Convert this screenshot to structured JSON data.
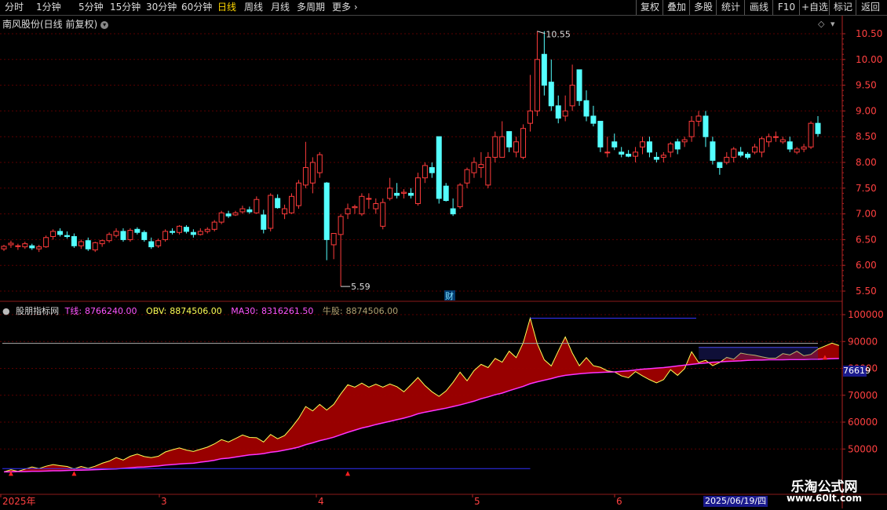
{
  "toolbar": {
    "periods": [
      "分时",
      "1分钟",
      "5分钟",
      "15分钟",
      "30分钟",
      "60分钟",
      "日线",
      "周线",
      "月线",
      "多周期",
      "更多"
    ],
    "active_period": "日线",
    "right_buttons": [
      "复权",
      "叠加",
      "多股",
      "统计",
      "画线",
      "F10",
      "+自选",
      "标记",
      "返回"
    ]
  },
  "main_panel": {
    "title": "南风股份(日线 前复权)",
    "y_ticks": [
      "10.50",
      "10.00",
      "9.50",
      "9.00",
      "8.50",
      "8.00",
      "7.50",
      "7.00",
      "6.50",
      "6.00",
      "5.50"
    ],
    "high_label": "10.55",
    "low_label": "5.59",
    "finance_marker": "财"
  },
  "indicator_panel": {
    "name": "股朋指标网",
    "fields": [
      {
        "label": "T线:",
        "value": "8766240.00",
        "color": "#ff55ff"
      },
      {
        "label": "OBV:",
        "value": "8874506.00",
        "color": "#ffff55"
      },
      {
        "label": "MA30:",
        "value": "8316261.50",
        "color": "#ff55ff"
      },
      {
        "label": "牛股:",
        "value": "8874506.00",
        "color": "#b0a070"
      }
    ],
    "y_ticks": [
      "100000",
      "90000",
      "80000",
      "70000",
      "60000",
      "50000"
    ],
    "current_value": "76619"
  },
  "x_axis": {
    "labels": [
      "2025年",
      "3",
      "4",
      "5",
      "6"
    ],
    "cursor_date": "2025/06/19/四"
  },
  "watermark": {
    "name": "乐淘公式网",
    "url": "www.60lt.com"
  },
  "colors": {
    "up": "#ff3b3b",
    "down": "#54ffff",
    "grid": "#5a0000",
    "axis": "#b22222",
    "fill": "#a00000"
  },
  "chart_data": [
    {
      "type": "candlestick",
      "title": "南风股份(日线 前复权)",
      "ylim": [
        5.4,
        10.6
      ],
      "ohlc": [
        [
          6.32,
          6.4,
          6.28,
          6.37
        ],
        [
          6.4,
          6.48,
          6.34,
          6.43
        ],
        [
          6.37,
          6.42,
          6.3,
          6.38
        ],
        [
          6.36,
          6.46,
          6.32,
          6.42
        ],
        [
          6.38,
          6.42,
          6.3,
          6.34
        ],
        [
          6.32,
          6.4,
          6.26,
          6.36
        ],
        [
          6.36,
          6.58,
          6.34,
          6.54
        ],
        [
          6.56,
          6.7,
          6.5,
          6.66
        ],
        [
          6.66,
          6.72,
          6.56,
          6.6
        ],
        [
          6.58,
          6.66,
          6.52,
          6.56
        ],
        [
          6.56,
          6.62,
          6.34,
          6.38
        ],
        [
          6.38,
          6.5,
          6.32,
          6.46
        ],
        [
          6.48,
          6.54,
          6.28,
          6.32
        ],
        [
          6.3,
          6.46,
          6.26,
          6.44
        ],
        [
          6.42,
          6.5,
          6.36,
          6.48
        ],
        [
          6.48,
          6.64,
          6.44,
          6.6
        ],
        [
          6.58,
          6.72,
          6.54,
          6.66
        ],
        [
          6.66,
          6.72,
          6.46,
          6.5
        ],
        [
          6.5,
          6.72,
          6.46,
          6.68
        ],
        [
          6.7,
          6.74,
          6.6,
          6.64
        ],
        [
          6.64,
          6.68,
          6.46,
          6.5
        ],
        [
          6.46,
          6.54,
          6.32,
          6.36
        ],
        [
          6.38,
          6.52,
          6.34,
          6.48
        ],
        [
          6.5,
          6.7,
          6.46,
          6.66
        ],
        [
          6.66,
          6.72,
          6.6,
          6.64
        ],
        [
          6.64,
          6.78,
          6.6,
          6.76
        ],
        [
          6.74,
          6.78,
          6.62,
          6.66
        ],
        [
          6.64,
          6.7,
          6.54,
          6.6
        ],
        [
          6.6,
          6.72,
          6.58,
          6.66
        ],
        [
          6.66,
          6.74,
          6.62,
          6.7
        ],
        [
          6.7,
          6.88,
          6.66,
          6.84
        ],
        [
          6.84,
          7.06,
          6.8,
          7.02
        ],
        [
          7.0,
          7.06,
          6.92,
          6.96
        ],
        [
          6.98,
          7.06,
          6.96,
          7.02
        ],
        [
          7.04,
          7.16,
          7.0,
          7.1
        ],
        [
          7.08,
          7.14,
          7.0,
          7.04
        ],
        [
          7.02,
          7.34,
          7.0,
          7.28
        ],
        [
          6.98,
          7.08,
          6.62,
          6.7
        ],
        [
          6.72,
          7.4,
          6.66,
          7.36
        ],
        [
          7.3,
          7.38,
          7.1,
          7.12
        ],
        [
          7.0,
          7.18,
          6.9,
          7.1
        ],
        [
          7.02,
          7.4,
          7.0,
          7.34
        ],
        [
          7.16,
          7.66,
          7.1,
          7.6
        ],
        [
          7.56,
          8.4,
          7.5,
          7.9
        ],
        [
          7.6,
          8.1,
          7.4,
          8.0
        ],
        [
          7.8,
          8.2,
          7.7,
          8.15
        ],
        [
          7.6,
          7.62,
          6.1,
          6.5
        ],
        [
          6.4,
          6.6,
          6.12,
          6.62
        ],
        [
          6.6,
          7.0,
          5.59,
          6.95
        ],
        [
          7.0,
          7.2,
          6.9,
          7.1
        ],
        [
          7.12,
          7.18,
          7.0,
          7.14
        ],
        [
          7.0,
          7.4,
          6.96,
          7.34
        ],
        [
          7.3,
          7.4,
          7.1,
          7.3
        ],
        [
          7.1,
          7.3,
          7.0,
          7.2
        ],
        [
          6.76,
          7.3,
          6.7,
          7.22
        ],
        [
          7.3,
          7.7,
          7.26,
          7.5
        ],
        [
          7.4,
          7.6,
          7.3,
          7.36
        ],
        [
          7.4,
          7.48,
          7.3,
          7.42
        ],
        [
          7.4,
          7.5,
          7.3,
          7.36
        ],
        [
          7.2,
          7.8,
          7.16,
          7.7
        ],
        [
          7.7,
          8.0,
          7.6,
          7.94
        ],
        [
          7.9,
          8.0,
          7.7,
          7.8
        ],
        [
          8.5,
          8.5,
          7.2,
          7.3
        ],
        [
          7.54,
          7.6,
          7.24,
          7.26
        ],
        [
          7.1,
          7.3,
          6.96,
          7.0
        ],
        [
          7.14,
          7.6,
          7.1,
          7.56
        ],
        [
          7.6,
          7.9,
          7.5,
          7.86
        ],
        [
          7.8,
          8.1,
          7.7,
          8.0
        ],
        [
          7.9,
          8.2,
          7.7,
          7.96
        ],
        [
          7.56,
          8.2,
          7.5,
          8.1
        ],
        [
          8.1,
          8.6,
          8.0,
          8.5
        ],
        [
          8.1,
          8.8,
          8.1,
          8.5
        ],
        [
          8.6,
          8.6,
          8.2,
          8.3
        ],
        [
          8.2,
          8.5,
          8.1,
          8.4
        ],
        [
          8.1,
          8.74,
          8.06,
          8.66
        ],
        [
          8.76,
          9.7,
          8.6,
          9.0
        ],
        [
          9.0,
          10.55,
          8.9,
          10.0
        ],
        [
          10.1,
          10.55,
          9.3,
          9.5
        ],
        [
          9.56,
          10.0,
          9.0,
          9.1
        ],
        [
          9.1,
          9.3,
          8.76,
          8.86
        ],
        [
          8.9,
          9.3,
          8.8,
          9.0
        ],
        [
          9.1,
          9.9,
          9.0,
          9.5
        ],
        [
          9.8,
          9.8,
          9.1,
          9.2
        ],
        [
          9.2,
          9.4,
          8.8,
          8.9
        ],
        [
          8.9,
          9.1,
          8.7,
          8.76
        ],
        [
          8.8,
          8.8,
          8.2,
          8.3
        ],
        [
          8.2,
          8.5,
          8.1,
          8.2
        ],
        [
          8.4,
          8.56,
          8.24,
          8.3
        ],
        [
          8.2,
          8.3,
          8.1,
          8.16
        ],
        [
          8.16,
          8.24,
          8.1,
          8.12
        ],
        [
          8.12,
          8.3,
          8.0,
          8.2
        ],
        [
          8.3,
          8.5,
          8.16,
          8.4
        ],
        [
          8.4,
          8.5,
          8.1,
          8.2
        ],
        [
          8.1,
          8.2,
          8.0,
          8.06
        ],
        [
          8.1,
          8.2,
          8.0,
          8.14
        ],
        [
          8.2,
          8.4,
          8.1,
          8.36
        ],
        [
          8.4,
          8.46,
          8.16,
          8.26
        ],
        [
          8.4,
          8.5,
          8.3,
          8.44
        ],
        [
          8.5,
          8.9,
          8.4,
          8.8
        ],
        [
          8.8,
          9.0,
          8.7,
          8.9
        ],
        [
          8.9,
          9.0,
          8.3,
          8.5
        ],
        [
          8.4,
          8.5,
          7.96,
          8.04
        ],
        [
          8.0,
          8.0,
          7.76,
          7.9
        ],
        [
          8.0,
          8.2,
          7.96,
          8.1
        ],
        [
          8.1,
          8.3,
          8.0,
          8.26
        ],
        [
          8.2,
          8.3,
          8.1,
          8.14
        ],
        [
          8.16,
          8.2,
          8.06,
          8.1
        ],
        [
          8.2,
          8.36,
          8.16,
          8.3
        ],
        [
          8.2,
          8.5,
          8.1,
          8.46
        ],
        [
          8.4,
          8.56,
          8.3,
          8.5
        ],
        [
          8.5,
          8.6,
          8.4,
          8.5
        ],
        [
          8.4,
          8.5,
          8.36,
          8.44
        ],
        [
          8.4,
          8.5,
          8.2,
          8.26
        ],
        [
          8.2,
          8.3,
          8.16,
          8.26
        ],
        [
          8.26,
          8.36,
          8.2,
          8.3
        ],
        [
          8.3,
          8.8,
          8.26,
          8.76
        ],
        [
          8.76,
          8.9,
          8.5,
          8.56
        ]
      ]
    },
    {
      "type": "area",
      "title": "股朋指标网",
      "ylim": [
        40000,
        105000
      ],
      "series": [
        {
          "name": "OBV",
          "values": [
            41500,
            42300,
            41700,
            42500,
            43300,
            42700,
            43600,
            44200,
            43800,
            43500,
            42600,
            43500,
            42800,
            43600,
            44700,
            45500,
            46800,
            45900,
            47300,
            48100,
            47200,
            46800,
            47300,
            48900,
            49700,
            50400,
            49600,
            49100,
            49900,
            50700,
            51900,
            53500,
            52600,
            53900,
            55200,
            54300,
            54200,
            52600,
            55400,
            53800,
            55000,
            58000,
            61400,
            65800,
            64200,
            66600,
            64500,
            66600,
            70500,
            73900,
            73000,
            74500,
            73000,
            74100,
            73000,
            74200,
            73200,
            71300,
            73900,
            76600,
            73600,
            71300,
            69600,
            71600,
            74800,
            78600,
            75400,
            79200,
            81500,
            80300,
            83700,
            82300,
            86400,
            84000,
            89500,
            98700,
            89200,
            83200,
            80900,
            86400,
            91700,
            85700,
            81000,
            84000,
            81000,
            80400,
            79100,
            78700,
            77200,
            76500,
            78800,
            77200,
            75800,
            74600,
            75800,
            79500,
            77400,
            79900,
            86200,
            82200,
            83000,
            81000,
            82200,
            84100,
            83400,
            85700,
            85200,
            84900,
            84300,
            83800,
            83800,
            85500,
            85000,
            86400,
            84700,
            85200,
            87200,
            88300,
            89400,
            88500
          ]
        },
        {
          "name": "MA30",
          "values": [
            41500,
            41500,
            41600,
            41600,
            41700,
            41700,
            41800,
            41900,
            41900,
            42000,
            42100,
            42100,
            42200,
            42300,
            42400,
            42500,
            42600,
            42800,
            43000,
            43200,
            43300,
            43500,
            43700,
            44000,
            44200,
            44400,
            44600,
            44700,
            45100,
            45400,
            45800,
            46400,
            46600,
            47000,
            47400,
            47800,
            48000,
            48300,
            48800,
            49100,
            49600,
            50100,
            50700,
            51600,
            52300,
            53100,
            53700,
            54400,
            55300,
            56200,
            57000,
            57800,
            58400,
            59100,
            59700,
            60300,
            60900,
            61500,
            62200,
            63100,
            63700,
            64200,
            64700,
            65200,
            65800,
            66400,
            67100,
            67800,
            68700,
            69400,
            70200,
            70800,
            71700,
            72500,
            73300,
            74300,
            75000,
            75600,
            76200,
            76900,
            77400,
            77700,
            78000,
            78200,
            78400,
            78500,
            78600,
            78700,
            78900,
            79100,
            79400,
            79700,
            79900,
            80100,
            80300,
            80600,
            80900,
            81200,
            81500,
            81800,
            82000,
            82300,
            82400,
            82600,
            82700,
            82800,
            83000,
            83100,
            83100,
            83200,
            83200,
            83200,
            83300,
            83300,
            83300,
            83400,
            83400,
            83500,
            83600,
            83700
          ]
        }
      ]
    }
  ]
}
